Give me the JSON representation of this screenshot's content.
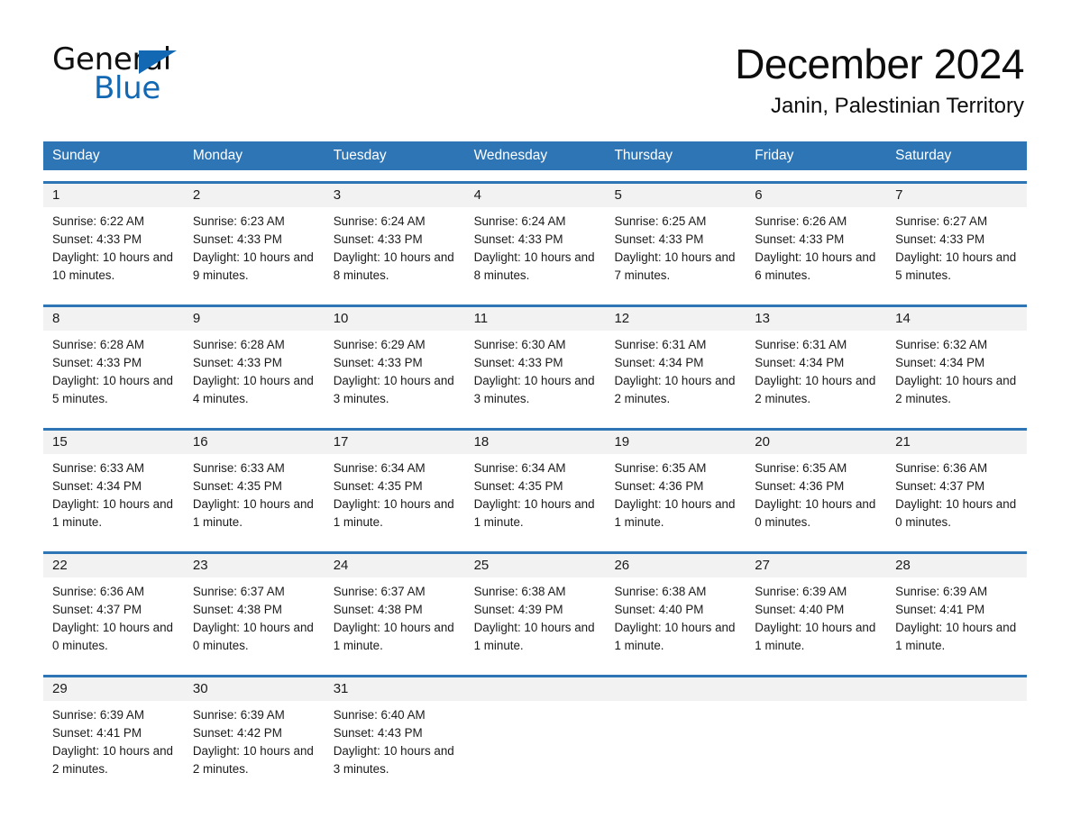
{
  "brand": {
    "name_part1": "General",
    "name_part2": "Blue",
    "triangle_color": "#1268b3"
  },
  "header": {
    "title": "December 2024",
    "subtitle": "Janin, Palestinian Territory",
    "accent_color": "#2e75b6",
    "daynum_band_color": "#f2f2f2"
  },
  "weekdays": [
    "Sunday",
    "Monday",
    "Tuesday",
    "Wednesday",
    "Thursday",
    "Friday",
    "Saturday"
  ],
  "weeks": [
    {
      "days": [
        {
          "num": "1",
          "sunrise": "Sunrise: 6:22 AM",
          "sunset": "Sunset: 4:33 PM",
          "daylight": "Daylight: 10 hours and 10 minutes."
        },
        {
          "num": "2",
          "sunrise": "Sunrise: 6:23 AM",
          "sunset": "Sunset: 4:33 PM",
          "daylight": "Daylight: 10 hours and 9 minutes."
        },
        {
          "num": "3",
          "sunrise": "Sunrise: 6:24 AM",
          "sunset": "Sunset: 4:33 PM",
          "daylight": "Daylight: 10 hours and 8 minutes."
        },
        {
          "num": "4",
          "sunrise": "Sunrise: 6:24 AM",
          "sunset": "Sunset: 4:33 PM",
          "daylight": "Daylight: 10 hours and 8 minutes."
        },
        {
          "num": "5",
          "sunrise": "Sunrise: 6:25 AM",
          "sunset": "Sunset: 4:33 PM",
          "daylight": "Daylight: 10 hours and 7 minutes."
        },
        {
          "num": "6",
          "sunrise": "Sunrise: 6:26 AM",
          "sunset": "Sunset: 4:33 PM",
          "daylight": "Daylight: 10 hours and 6 minutes."
        },
        {
          "num": "7",
          "sunrise": "Sunrise: 6:27 AM",
          "sunset": "Sunset: 4:33 PM",
          "daylight": "Daylight: 10 hours and 5 minutes."
        }
      ]
    },
    {
      "days": [
        {
          "num": "8",
          "sunrise": "Sunrise: 6:28 AM",
          "sunset": "Sunset: 4:33 PM",
          "daylight": "Daylight: 10 hours and 5 minutes."
        },
        {
          "num": "9",
          "sunrise": "Sunrise: 6:28 AM",
          "sunset": "Sunset: 4:33 PM",
          "daylight": "Daylight: 10 hours and 4 minutes."
        },
        {
          "num": "10",
          "sunrise": "Sunrise: 6:29 AM",
          "sunset": "Sunset: 4:33 PM",
          "daylight": "Daylight: 10 hours and 3 minutes."
        },
        {
          "num": "11",
          "sunrise": "Sunrise: 6:30 AM",
          "sunset": "Sunset: 4:33 PM",
          "daylight": "Daylight: 10 hours and 3 minutes."
        },
        {
          "num": "12",
          "sunrise": "Sunrise: 6:31 AM",
          "sunset": "Sunset: 4:34 PM",
          "daylight": "Daylight: 10 hours and 2 minutes."
        },
        {
          "num": "13",
          "sunrise": "Sunrise: 6:31 AM",
          "sunset": "Sunset: 4:34 PM",
          "daylight": "Daylight: 10 hours and 2 minutes."
        },
        {
          "num": "14",
          "sunrise": "Sunrise: 6:32 AM",
          "sunset": "Sunset: 4:34 PM",
          "daylight": "Daylight: 10 hours and 2 minutes."
        }
      ]
    },
    {
      "days": [
        {
          "num": "15",
          "sunrise": "Sunrise: 6:33 AM",
          "sunset": "Sunset: 4:34 PM",
          "daylight": "Daylight: 10 hours and 1 minute."
        },
        {
          "num": "16",
          "sunrise": "Sunrise: 6:33 AM",
          "sunset": "Sunset: 4:35 PM",
          "daylight": "Daylight: 10 hours and 1 minute."
        },
        {
          "num": "17",
          "sunrise": "Sunrise: 6:34 AM",
          "sunset": "Sunset: 4:35 PM",
          "daylight": "Daylight: 10 hours and 1 minute."
        },
        {
          "num": "18",
          "sunrise": "Sunrise: 6:34 AM",
          "sunset": "Sunset: 4:35 PM",
          "daylight": "Daylight: 10 hours and 1 minute."
        },
        {
          "num": "19",
          "sunrise": "Sunrise: 6:35 AM",
          "sunset": "Sunset: 4:36 PM",
          "daylight": "Daylight: 10 hours and 1 minute."
        },
        {
          "num": "20",
          "sunrise": "Sunrise: 6:35 AM",
          "sunset": "Sunset: 4:36 PM",
          "daylight": "Daylight: 10 hours and 0 minutes."
        },
        {
          "num": "21",
          "sunrise": "Sunrise: 6:36 AM",
          "sunset": "Sunset: 4:37 PM",
          "daylight": "Daylight: 10 hours and 0 minutes."
        }
      ]
    },
    {
      "days": [
        {
          "num": "22",
          "sunrise": "Sunrise: 6:36 AM",
          "sunset": "Sunset: 4:37 PM",
          "daylight": "Daylight: 10 hours and 0 minutes."
        },
        {
          "num": "23",
          "sunrise": "Sunrise: 6:37 AM",
          "sunset": "Sunset: 4:38 PM",
          "daylight": "Daylight: 10 hours and 0 minutes."
        },
        {
          "num": "24",
          "sunrise": "Sunrise: 6:37 AM",
          "sunset": "Sunset: 4:38 PM",
          "daylight": "Daylight: 10 hours and 1 minute."
        },
        {
          "num": "25",
          "sunrise": "Sunrise: 6:38 AM",
          "sunset": "Sunset: 4:39 PM",
          "daylight": "Daylight: 10 hours and 1 minute."
        },
        {
          "num": "26",
          "sunrise": "Sunrise: 6:38 AM",
          "sunset": "Sunset: 4:40 PM",
          "daylight": "Daylight: 10 hours and 1 minute."
        },
        {
          "num": "27",
          "sunrise": "Sunrise: 6:39 AM",
          "sunset": "Sunset: 4:40 PM",
          "daylight": "Daylight: 10 hours and 1 minute."
        },
        {
          "num": "28",
          "sunrise": "Sunrise: 6:39 AM",
          "sunset": "Sunset: 4:41 PM",
          "daylight": "Daylight: 10 hours and 1 minute."
        }
      ]
    },
    {
      "days": [
        {
          "num": "29",
          "sunrise": "Sunrise: 6:39 AM",
          "sunset": "Sunset: 4:41 PM",
          "daylight": "Daylight: 10 hours and 2 minutes."
        },
        {
          "num": "30",
          "sunrise": "Sunrise: 6:39 AM",
          "sunset": "Sunset: 4:42 PM",
          "daylight": "Daylight: 10 hours and 2 minutes."
        },
        {
          "num": "31",
          "sunrise": "Sunrise: 6:40 AM",
          "sunset": "Sunset: 4:43 PM",
          "daylight": "Daylight: 10 hours and 3 minutes."
        },
        {
          "num": "",
          "sunrise": "",
          "sunset": "",
          "daylight": ""
        },
        {
          "num": "",
          "sunrise": "",
          "sunset": "",
          "daylight": ""
        },
        {
          "num": "",
          "sunrise": "",
          "sunset": "",
          "daylight": ""
        },
        {
          "num": "",
          "sunrise": "",
          "sunset": "",
          "daylight": ""
        }
      ]
    }
  ]
}
